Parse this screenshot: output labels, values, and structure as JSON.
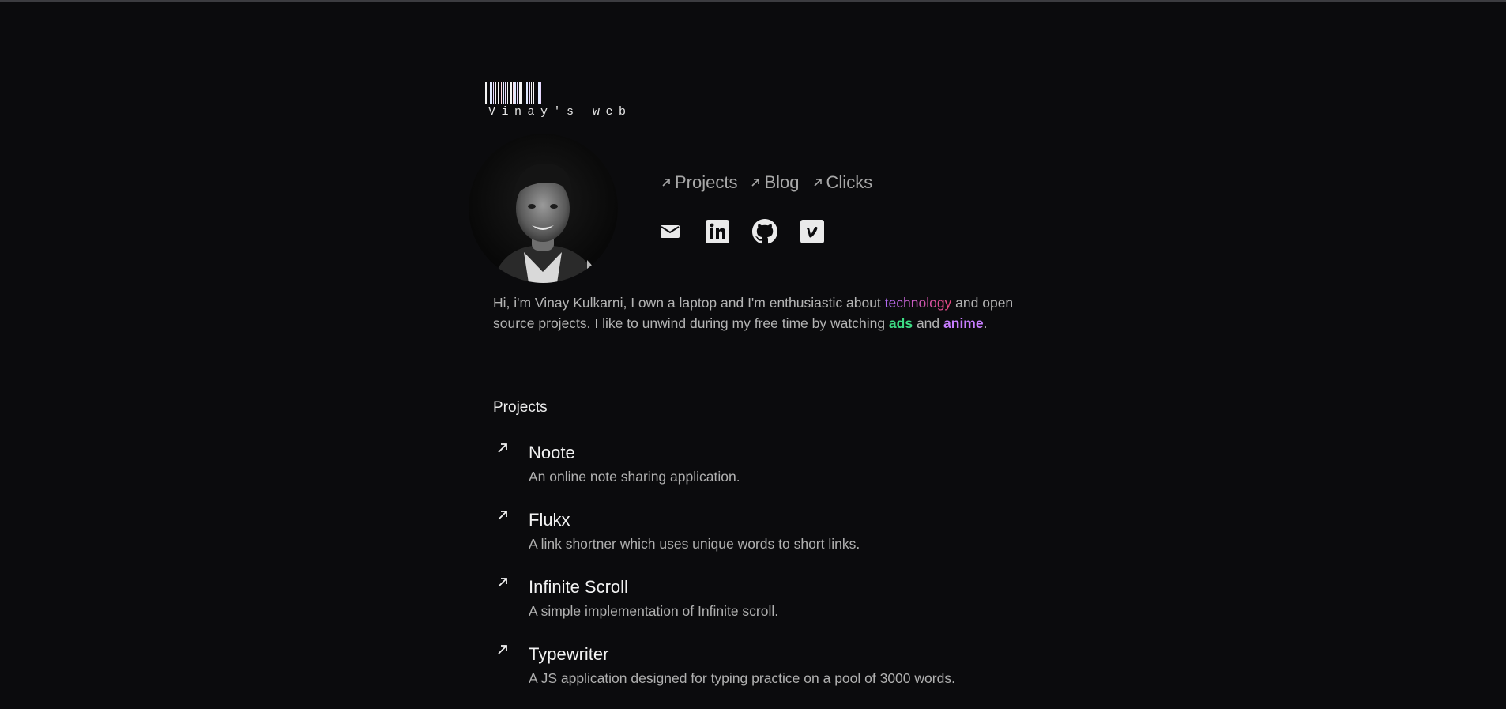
{
  "brand": {
    "logo_text": "Vinay's web"
  },
  "nav": {
    "links": [
      {
        "label": "Projects"
      },
      {
        "label": "Blog"
      },
      {
        "label": "Clicks"
      }
    ]
  },
  "socials": {
    "items": [
      {
        "icon": "mail-icon"
      },
      {
        "icon": "linkedin-icon"
      },
      {
        "icon": "github-icon"
      },
      {
        "icon": "vimeo-icon"
      }
    ]
  },
  "bio": {
    "part1": "Hi, i'm Vinay Kulkarni, I own a laptop and I'm enthusiastic about ",
    "highlight1": "technology",
    "part2": " and open source projects. I like to unwind during my free time by watching ",
    "highlight2": "ads",
    "part3": " and ",
    "highlight3": "anime",
    "part4": "."
  },
  "projects": {
    "heading": "Projects",
    "items": [
      {
        "title": "Noote",
        "description": "An online note sharing application."
      },
      {
        "title": "Flukx",
        "description": "A link shortner which uses unique words to short links."
      },
      {
        "title": "Infinite Scroll",
        "description": "A simple implementation of Infinite scroll."
      },
      {
        "title": "Typewriter",
        "description": "A JS application designed for typing practice on a pool of 3000 words."
      }
    ]
  },
  "colors": {
    "background": "#0b0b0d",
    "highlight_tech_start": "#b06bf2",
    "highlight_tech_end": "#e8477f",
    "highlight_ads": "#3ddc84",
    "highlight_anime": "#c77dff"
  }
}
